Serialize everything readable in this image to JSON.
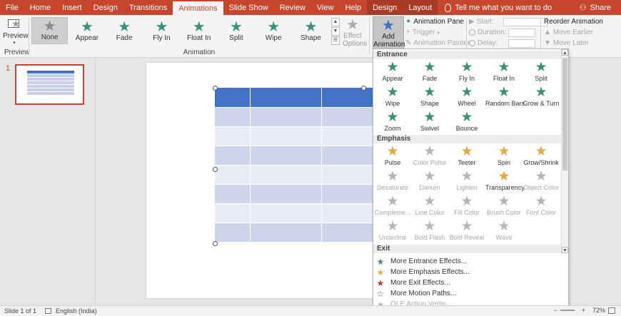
{
  "tabs": [
    {
      "label": "File"
    },
    {
      "label": "Home"
    },
    {
      "label": "Insert"
    },
    {
      "label": "Design"
    },
    {
      "label": "Transitions"
    },
    {
      "label": "Animations",
      "active": true
    },
    {
      "label": "Slide Show"
    },
    {
      "label": "Review"
    },
    {
      "label": "View"
    },
    {
      "label": "Help"
    },
    {
      "label": "Design",
      "contextual": true
    },
    {
      "label": "Layout",
      "contextual": true
    }
  ],
  "tell_me": "Tell me what you want to do",
  "share_label": "Share",
  "ribbon": {
    "preview_label": "Preview",
    "preview_group": "Preview",
    "animation_group": "Animation",
    "gallery": [
      "None",
      "Appear",
      "Fade",
      "Fly In",
      "Float In",
      "Split",
      "Wipe",
      "Shape"
    ],
    "effect_options_1": "Effect",
    "effect_options_2": "Options",
    "add_animation_1": "Add",
    "add_animation_2": "Animation",
    "animation_pane": "Animation Pane",
    "trigger": "Trigger",
    "animation_painter": "Animation Painter",
    "start_label": "Start:",
    "duration_label": "Duration:",
    "delay_label": "Delay:",
    "reorder_title": "Reorder Animation",
    "move_earlier": "Move Earlier",
    "move_later": "Move Later"
  },
  "thumbnails": {
    "slide_number": "1"
  },
  "dropdown": {
    "entrance_title": "Entrance",
    "entrance": [
      "Appear",
      "Fade",
      "Fly In",
      "Float In",
      "Split",
      "Wipe",
      "Shape",
      "Wheel",
      "Random Bars",
      "Grow & Turn",
      "Zoom",
      "Swivel",
      "Bounce"
    ],
    "emphasis_title": "Emphasis",
    "emphasis": [
      {
        "label": "Pulse",
        "enabled": true
      },
      {
        "label": "Color Pulse",
        "enabled": false
      },
      {
        "label": "Teeter",
        "enabled": true
      },
      {
        "label": "Spin",
        "enabled": true
      },
      {
        "label": "Grow/Shrink",
        "enabled": true
      },
      {
        "label": "Desaturate",
        "enabled": false
      },
      {
        "label": "Darken",
        "enabled": false
      },
      {
        "label": "Lighten",
        "enabled": false
      },
      {
        "label": "Transparency",
        "enabled": true
      },
      {
        "label": "Object Color",
        "enabled": false
      },
      {
        "label": "Compleme...",
        "enabled": false
      },
      {
        "label": "Line Color",
        "enabled": false
      },
      {
        "label": "Fill Color",
        "enabled": false
      },
      {
        "label": "Brush Color",
        "enabled": false
      },
      {
        "label": "Font Color",
        "enabled": false
      },
      {
        "label": "Underline",
        "enabled": false
      },
      {
        "label": "Bold Flash",
        "enabled": false
      },
      {
        "label": "Bold Reveal",
        "enabled": false
      },
      {
        "label": "Wave",
        "enabled": false
      }
    ],
    "exit_title": "Exit",
    "more": [
      {
        "label": "More Entrance Effects...",
        "color": "#3e8f79",
        "enabled": true
      },
      {
        "label": "More Emphasis Effects...",
        "color": "#e2a93c",
        "enabled": true
      },
      {
        "label": "More Exit Effects...",
        "color": "#c0392b",
        "enabled": true
      },
      {
        "label": "More Motion Paths...",
        "color": "#ffffff",
        "enabled": true
      },
      {
        "label": "OLE Action Verbs...",
        "color": "#b5b5b5",
        "enabled": false
      }
    ]
  },
  "status": {
    "slide_info": "Slide 1 of 1",
    "language": "English (India)",
    "zoom": "72%"
  },
  "colors": {
    "accent": "#c5462c",
    "entrance": "#3e8f79",
    "emphasis": "#e2a93c",
    "table_header": "#4472c4"
  }
}
